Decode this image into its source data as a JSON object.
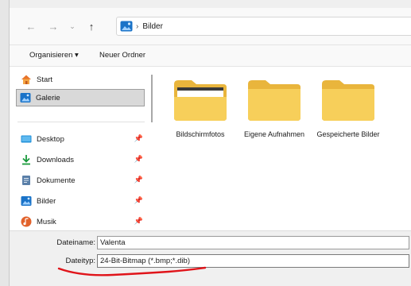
{
  "navigation": {
    "address_path": [
      "Bilder"
    ]
  },
  "command_bar": {
    "organize_label": "Organisieren ▾",
    "new_folder_label": "Neuer Ordner"
  },
  "sidebar": {
    "top_items": [
      {
        "label": "Start",
        "icon": "home-icon"
      },
      {
        "label": "Galerie",
        "icon": "gallery-icon",
        "selected": true
      }
    ],
    "quick_access": [
      {
        "label": "Desktop",
        "icon": "desktop-icon",
        "pinned": true
      },
      {
        "label": "Downloads",
        "icon": "download-icon",
        "pinned": true
      },
      {
        "label": "Dokumente",
        "icon": "document-icon",
        "pinned": true
      },
      {
        "label": "Bilder",
        "icon": "pictures-icon",
        "pinned": true
      },
      {
        "label": "Musik",
        "icon": "music-icon",
        "pinned": true
      }
    ]
  },
  "folders": [
    {
      "name": "Bildschirmfotos"
    },
    {
      "name": "Eigene Aufnahmen"
    },
    {
      "name": "Gespeicherte Bilder"
    }
  ],
  "file_fields": {
    "filename_label": "Dateiname:",
    "filename_value": "Valenta",
    "filetype_label": "Dateityp:",
    "filetype_value": "24-Bit-Bitmap (*.bmp;*.dib)"
  },
  "colors": {
    "folder_yellow": "#f7cf5a",
    "folder_dark": "#e9b53c",
    "accent_blue": "#1a73c8",
    "annotation_red": "#e0141a"
  }
}
